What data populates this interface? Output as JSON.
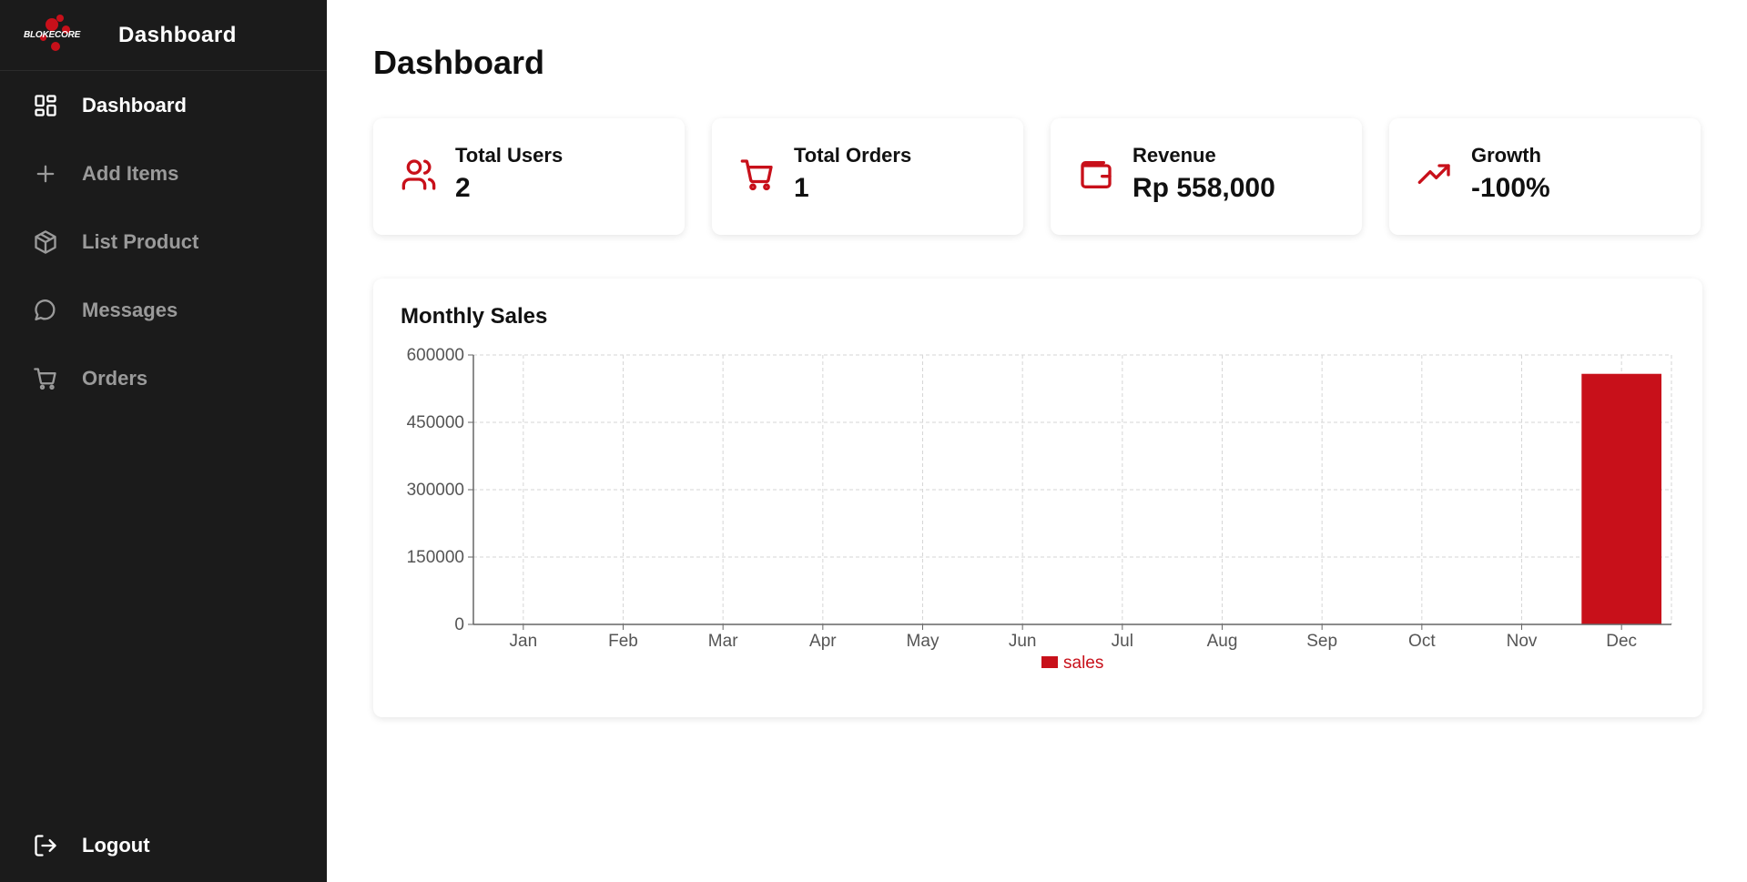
{
  "sidebar": {
    "logo_text": "BLOKECORE",
    "title": "Dashboard",
    "items": [
      {
        "label": "Dashboard",
        "icon": "grid-icon",
        "active": true
      },
      {
        "label": "Add Items",
        "icon": "plus-icon",
        "active": false
      },
      {
        "label": "List Product",
        "icon": "box-icon",
        "active": false
      },
      {
        "label": "Messages",
        "icon": "chat-icon",
        "active": false
      },
      {
        "label": "Orders",
        "icon": "cart-icon",
        "active": false
      }
    ],
    "logout_label": "Logout"
  },
  "main": {
    "title": "Dashboard",
    "stats": [
      {
        "label": "Total Users",
        "value": "2",
        "icon": "users-icon"
      },
      {
        "label": "Total Orders",
        "value": "1",
        "icon": "cart-icon"
      },
      {
        "label": "Revenue",
        "value": "Rp 558,000",
        "icon": "wallet-icon"
      },
      {
        "label": "Growth",
        "value": "-100%",
        "icon": "trending-up-icon"
      }
    ]
  },
  "colors": {
    "accent": "#c8101a",
    "sidebar_bg": "#1b1b1b"
  },
  "chart_data": {
    "type": "bar",
    "title": "Monthly Sales",
    "categories": [
      "Jan",
      "Feb",
      "Mar",
      "Apr",
      "May",
      "Jun",
      "Jul",
      "Aug",
      "Sep",
      "Oct",
      "Nov",
      "Dec"
    ],
    "series": [
      {
        "name": "sales",
        "values": [
          0,
          0,
          0,
          0,
          0,
          0,
          0,
          0,
          0,
          0,
          0,
          558000
        ],
        "color": "#c8101a"
      }
    ],
    "y_ticks": [
      0,
      150000,
      300000,
      450000,
      600000
    ],
    "ylim": [
      0,
      600000
    ],
    "grid": true,
    "legend_position": "bottom-center"
  }
}
